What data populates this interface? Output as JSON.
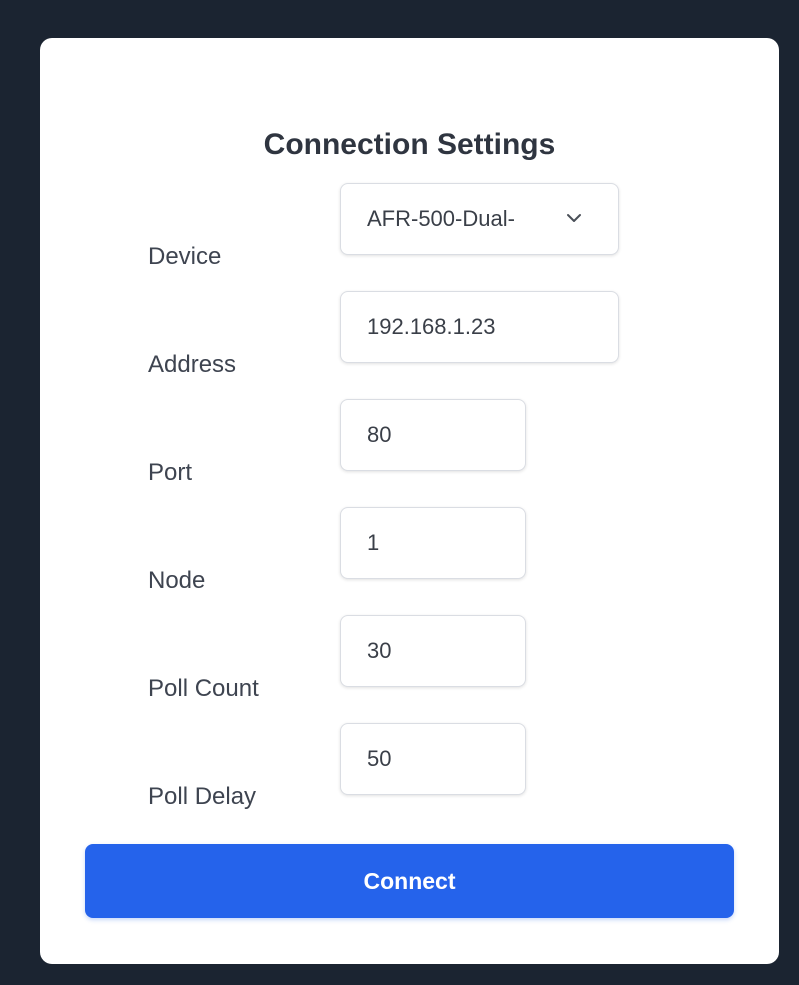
{
  "form": {
    "title": "Connection Settings",
    "fields": [
      {
        "label": "Device",
        "value": "AFR-500-Dual-",
        "type": "select"
      },
      {
        "label": "Address",
        "value": "192.168.1.23",
        "type": "text"
      },
      {
        "label": "Port",
        "value": "80",
        "type": "text"
      },
      {
        "label": "Node",
        "value": "1",
        "type": "text"
      },
      {
        "label": "Poll Count",
        "value": "30",
        "type": "text"
      },
      {
        "label": "Poll Delay",
        "value": "50",
        "type": "text"
      }
    ],
    "connect_label": "Connect"
  },
  "colors": {
    "background": "#1b2431",
    "card": "#ffffff",
    "accent": "#2563eb"
  },
  "icons": {
    "device_dropdown": "chevron-down-icon"
  }
}
